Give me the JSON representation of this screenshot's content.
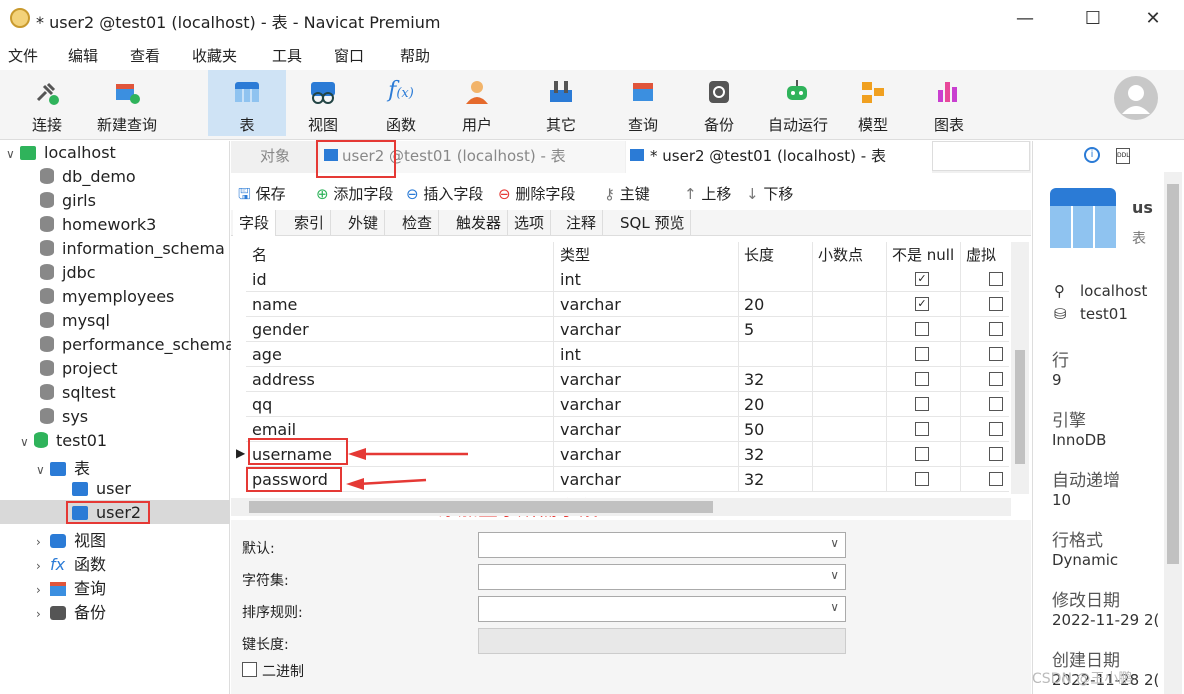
{
  "window": {
    "title": "* user2 @test01 (localhost) - 表 - Navicat Premium"
  },
  "menu": [
    "文件",
    "编辑",
    "查看",
    "收藏夹",
    "工具",
    "窗口",
    "帮助"
  ],
  "toolbar": [
    {
      "label": "连接",
      "icon": "plug-icon"
    },
    {
      "label": "新建查询",
      "icon": "new-query-icon"
    },
    {
      "label": "表",
      "icon": "table-icon"
    },
    {
      "label": "视图",
      "icon": "view-icon"
    },
    {
      "label": "函数",
      "icon": "function-icon"
    },
    {
      "label": "用户",
      "icon": "user-icon"
    },
    {
      "label": "其它",
      "icon": "tools-icon"
    },
    {
      "label": "查询",
      "icon": "query-icon"
    },
    {
      "label": "备份",
      "icon": "backup-icon"
    },
    {
      "label": "自动运行",
      "icon": "robot-icon"
    },
    {
      "label": "模型",
      "icon": "model-icon"
    },
    {
      "label": "图表",
      "icon": "chart-icon"
    }
  ],
  "tree": {
    "root": "localhost",
    "databases": [
      "db_demo",
      "girls",
      "homework3",
      "information_schema",
      "jdbc",
      "myemployees",
      "mysql",
      "performance_schema",
      "project",
      "sqltest",
      "sys"
    ],
    "open_db": "test01",
    "tables_folder": "表",
    "tables": [
      "user",
      "user2"
    ],
    "folders": [
      "视图",
      "函数",
      "查询",
      "备份"
    ]
  },
  "tabs": {
    "objects": "对象",
    "tab1": "user2 @test01 (localhost) - 表",
    "tab2": "* user2 @test01 (localhost) - 表"
  },
  "subtoolbar": {
    "save": "保存",
    "add": "添加字段",
    "insert": "插入字段",
    "delete": "删除字段",
    "pk": "主键",
    "up": "上移",
    "down": "下移"
  },
  "field_tabs": [
    "字段",
    "索引",
    "外键",
    "检查",
    "触发器",
    "选项",
    "注释",
    "SQL 预览"
  ],
  "columns": [
    "名",
    "类型",
    "长度",
    "小数点",
    "不是 null",
    "虚拟"
  ],
  "rows": [
    {
      "name": "id",
      "type": "int",
      "len": "",
      "notnull": true
    },
    {
      "name": "name",
      "type": "varchar",
      "len": "20",
      "notnull": true
    },
    {
      "name": "gender",
      "type": "varchar",
      "len": "5",
      "notnull": false
    },
    {
      "name": "age",
      "type": "int",
      "len": "",
      "notnull": false
    },
    {
      "name": "address",
      "type": "varchar",
      "len": "32",
      "notnull": false
    },
    {
      "name": "qq",
      "type": "varchar",
      "len": "20",
      "notnull": false
    },
    {
      "name": "email",
      "type": "varchar",
      "len": "50",
      "notnull": false
    },
    {
      "name": "username",
      "type": "varchar",
      "len": "32",
      "notnull": false
    },
    {
      "name": "password",
      "type": "varchar",
      "len": "32",
      "notnull": false
    }
  ],
  "annotation": "添加登录所需字段",
  "props": {
    "default": "默认:",
    "charset": "字符集:",
    "collation": "排序规则:",
    "keylen": "键长度:",
    "binary": "二进制"
  },
  "info": {
    "title": "us",
    "subtitle": "表",
    "server": "localhost",
    "db": "test01",
    "rows_label": "行",
    "rows": "9",
    "engine_label": "引擎",
    "engine": "InnoDB",
    "autoinc_label": "自动递增",
    "autoinc": "10",
    "format_label": "行格式",
    "format": "Dynamic",
    "modified_label": "修改日期",
    "modified": "2022-11-29 2(",
    "created_label": "创建日期",
    "created": "2022-11-28 2("
  },
  "watermark": "CSDN @王小鹏",
  "colors": {
    "accent": "#2b7bd6",
    "annotation": "#e53935",
    "selected": "#d9d9d9"
  }
}
